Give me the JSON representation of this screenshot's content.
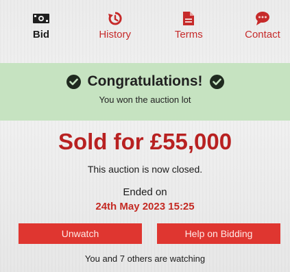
{
  "tabs": [
    {
      "label": "Bid",
      "icon": "money-icon",
      "active": true
    },
    {
      "label": "History",
      "icon": "history-icon",
      "active": false
    },
    {
      "label": "Terms",
      "icon": "document-icon",
      "active": false
    },
    {
      "label": "Contact",
      "icon": "chat-bubble-icon",
      "active": false
    }
  ],
  "banner": {
    "title": "Congratulations!",
    "subtitle": "You won the auction lot",
    "color": "#c6e3c1"
  },
  "result": {
    "sold_text": "Sold for £55,000",
    "closed_text": "This auction is now closed.",
    "ended_label": "Ended on",
    "ended_date": "24th May 2023 15:25"
  },
  "buttons": {
    "unwatch": "Unwatch",
    "help": "Help on Bidding"
  },
  "watching_text": "You and 7 others are watching",
  "colors": {
    "accent_red": "#df3630",
    "sold_red": "#b82121"
  }
}
